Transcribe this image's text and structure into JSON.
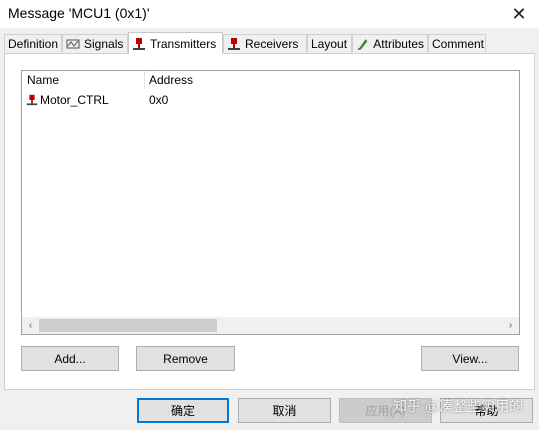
{
  "window": {
    "title": "Message 'MCU1 (0x1)'",
    "close_glyph": "✕"
  },
  "tabs": [
    {
      "label": "Definition",
      "icon": ""
    },
    {
      "label": "Signals",
      "icon": "signals-icon"
    },
    {
      "label": "Transmitters",
      "icon": "transmitter-node-icon",
      "active": true
    },
    {
      "label": "Receivers",
      "icon": "receiver-node-icon"
    },
    {
      "label": "Layout",
      "icon": ""
    },
    {
      "label": "Attributes",
      "icon": "attributes-pen-icon"
    },
    {
      "label": "Comment",
      "icon": ""
    }
  ],
  "list": {
    "columns": [
      "Name",
      "Address"
    ],
    "rows": [
      {
        "name": "Motor_CTRL",
        "address": "0x0",
        "icon": "node-icon"
      }
    ],
    "scroll_left": "‹",
    "scroll_right": "›"
  },
  "panel_buttons": {
    "add": "Add...",
    "remove": "Remove",
    "view": "View..."
  },
  "dialog_buttons": {
    "ok": "确定",
    "cancel": "取消",
    "apply": "应用(A)",
    "help": "帮助"
  },
  "watermark": "知乎 @凑整些实用的",
  "colors": {
    "accent": "#0078d7",
    "node_icon": "#c00000"
  }
}
